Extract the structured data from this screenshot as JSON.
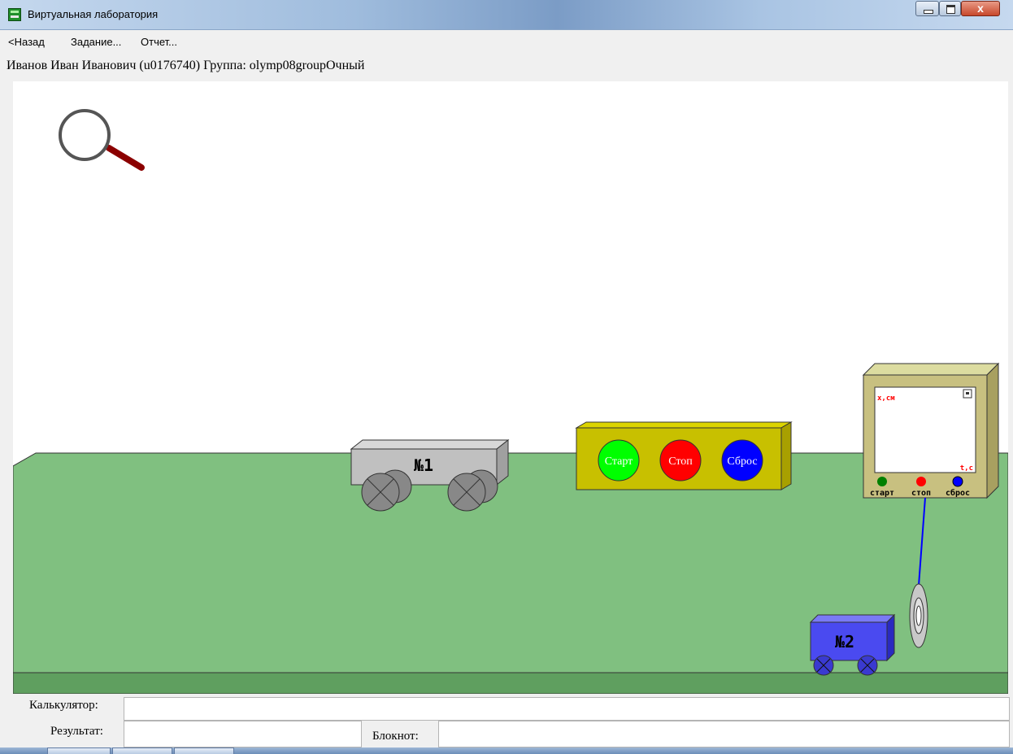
{
  "window": {
    "title": "Виртуальная лаборатория",
    "close_glyph": "x"
  },
  "menu": {
    "back": "<Назад",
    "task": "Задание...",
    "report": "Отчет..."
  },
  "user": {
    "info": "Иванов Иван Иванович (u0176740)  Группа: olymp08groupОчный"
  },
  "scene": {
    "icons": [
      "magnifier-icon"
    ],
    "cart1_label": "№1",
    "cart2_label": "№2",
    "control_panel": {
      "start": "Старт",
      "stop": "Стоп",
      "reset": "Сброс"
    },
    "sensor": {
      "y_axis": "x,см",
      "x_axis": "t,c",
      "start": "старт",
      "stop": "стоп",
      "reset": "сброс"
    },
    "colors": {
      "table": "#80c080",
      "table_front": "#5f9f5f",
      "cart1": "#c0c0c0",
      "cart2": "#4a4af0",
      "panel": "#c8c000",
      "monitor": "#c8c080",
      "start_button": "#00ff00",
      "stop_button": "#ff0000",
      "reset_button": "#0000ff"
    }
  },
  "bottom": {
    "calculator_label": "Калькулятор:",
    "result_label": "Результат:",
    "notepad_label": "Блокнот:",
    "calculator_value": "",
    "result_value": "",
    "notepad_value": ""
  }
}
